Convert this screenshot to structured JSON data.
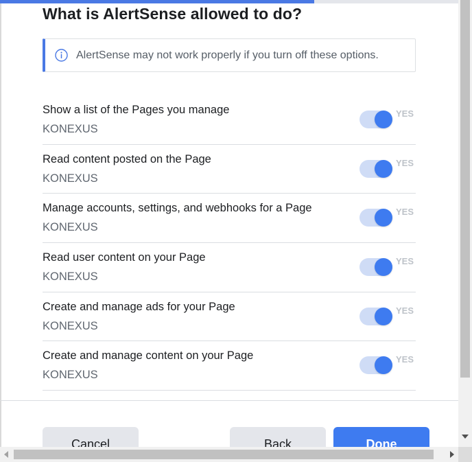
{
  "dialog": {
    "title": "What is AlertSense allowed to do?",
    "progress": 0.685,
    "notice": {
      "icon": "info-icon",
      "text": "AlertSense may not work properly if you turn off these options."
    }
  },
  "permissions": [
    {
      "label": "Show a list of the Pages you manage",
      "page": "KONEXUS",
      "state": "YES",
      "on": true
    },
    {
      "label": "Read content posted on the Page",
      "page": "KONEXUS",
      "state": "YES",
      "on": true
    },
    {
      "label": "Manage accounts, settings, and webhooks for a Page",
      "page": "KONEXUS",
      "state": "YES",
      "on": true
    },
    {
      "label": "Read user content on your Page",
      "page": "KONEXUS",
      "state": "YES",
      "on": true
    },
    {
      "label": "Create and manage ads for your Page",
      "page": "KONEXUS",
      "state": "YES",
      "on": true
    },
    {
      "label": "Create and manage content on your Page",
      "page": "KONEXUS",
      "state": "YES",
      "on": true
    }
  ],
  "buttons": {
    "cancel": "Cancel",
    "back": "Back",
    "done": "Done"
  },
  "colors": {
    "accent": "#3e7bf0",
    "toggle_track": "#cfdcf6",
    "notice_border": "#4a79e4"
  }
}
